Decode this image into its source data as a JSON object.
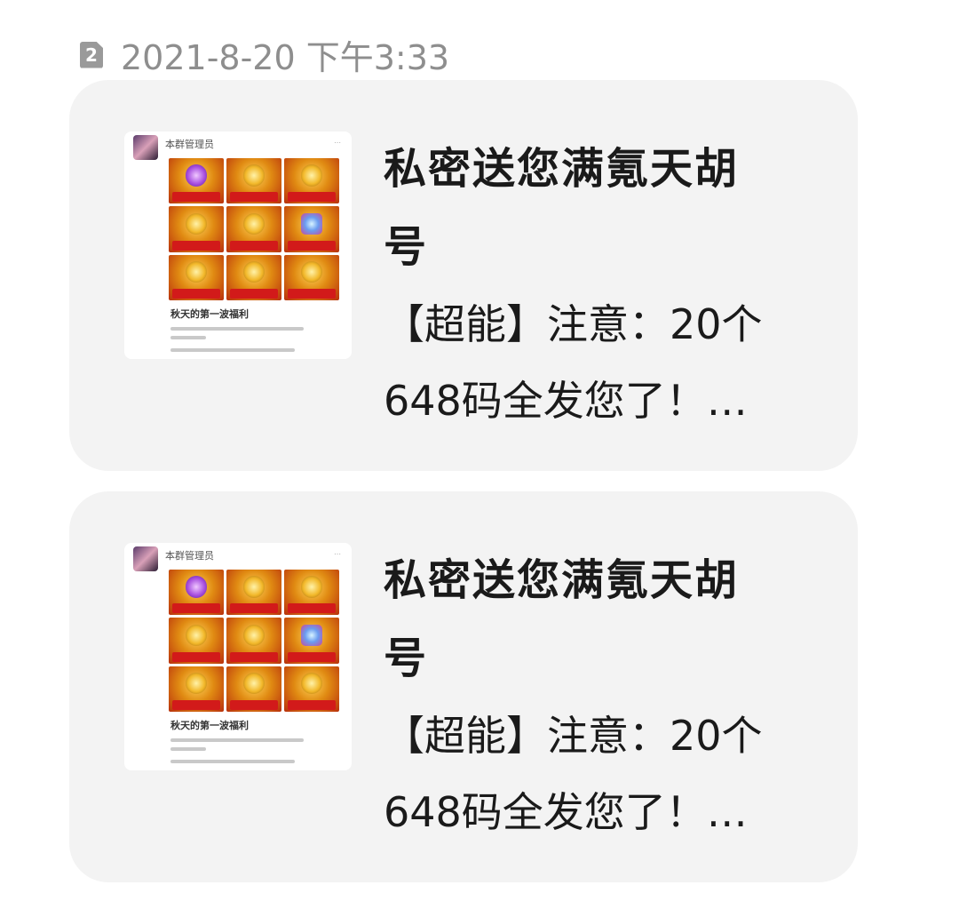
{
  "header": {
    "sim_slot": "2",
    "timestamp": "2021-8-20 下午3:33"
  },
  "messages": [
    {
      "thumbnail": {
        "sender": "本群管理员",
        "caption": "秋天的第一波福利"
      },
      "title_line1": "私密送您满氪天胡",
      "title_line2": "号",
      "body_line1": "【超能】注意：20个",
      "body_line2": "648码全发您了！…"
    },
    {
      "thumbnail": {
        "sender": "本群管理员",
        "caption": "秋天的第一波福利"
      },
      "title_line1": "私密送您满氪天胡",
      "title_line2": "号",
      "body_line1": "【超能】注意：20个",
      "body_line2": "648码全发您了！…"
    }
  ]
}
